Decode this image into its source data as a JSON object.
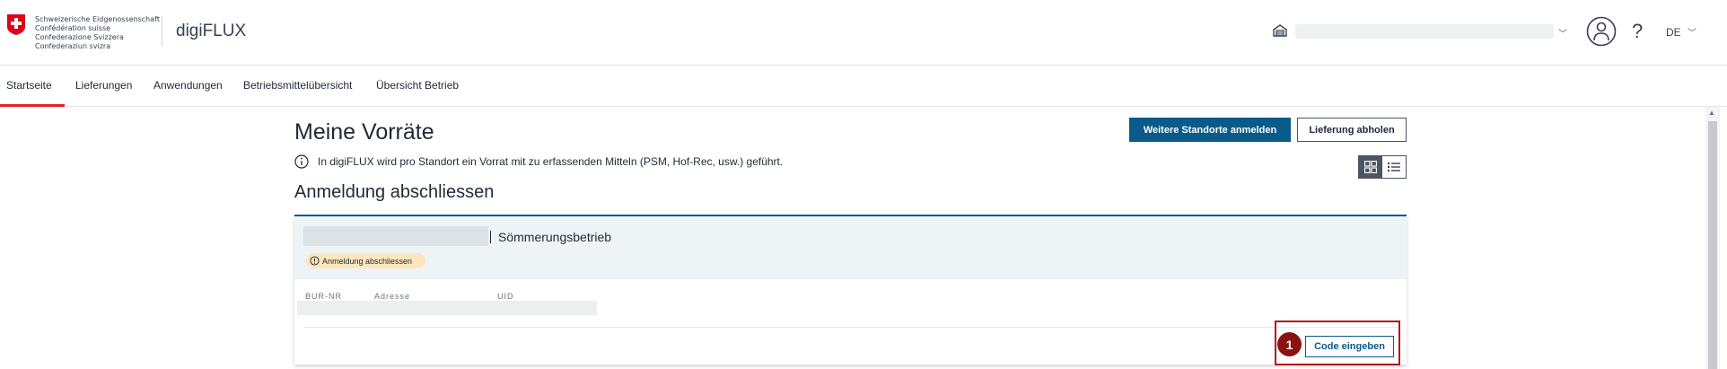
{
  "header": {
    "confederation_lines": [
      "Schweizerische Eidgenossenschaft",
      "Confédération suisse",
      "Confederazione Svizzera",
      "Confederaziun svizra"
    ],
    "app_name": "digiFLUX",
    "language": "DE",
    "help_label": "?"
  },
  "nav": {
    "items": [
      "Startseite",
      "Lieferungen",
      "Anwendungen",
      "Betriebsmittelübersicht",
      "Übersicht Betrieb"
    ],
    "active": "Startseite"
  },
  "page": {
    "title": "Meine Vorräte",
    "primary_button": "Weitere Standorte anmelden",
    "secondary_button": "Lieferung abholen",
    "info_text": "In digiFLUX wird pro Standort ein Vorrat mit zu erfassenden Mitteln (PSM, Hof-Rec, usw.) geführt.",
    "section_title": "Anmeldung abschliessen"
  },
  "card": {
    "title": "Sömmerungsbetrieb",
    "badge": "Anmeldung abschliessen",
    "columns": [
      "BUR-NR",
      "Adresse",
      "UID"
    ],
    "code_button": "Code eingeben"
  },
  "callout": {
    "number": "1",
    "color": "#b01518"
  },
  "colors": {
    "primary": "#0a5a8a",
    "active_tab": "#dc2626",
    "badge_bg": "#fde6bd"
  }
}
